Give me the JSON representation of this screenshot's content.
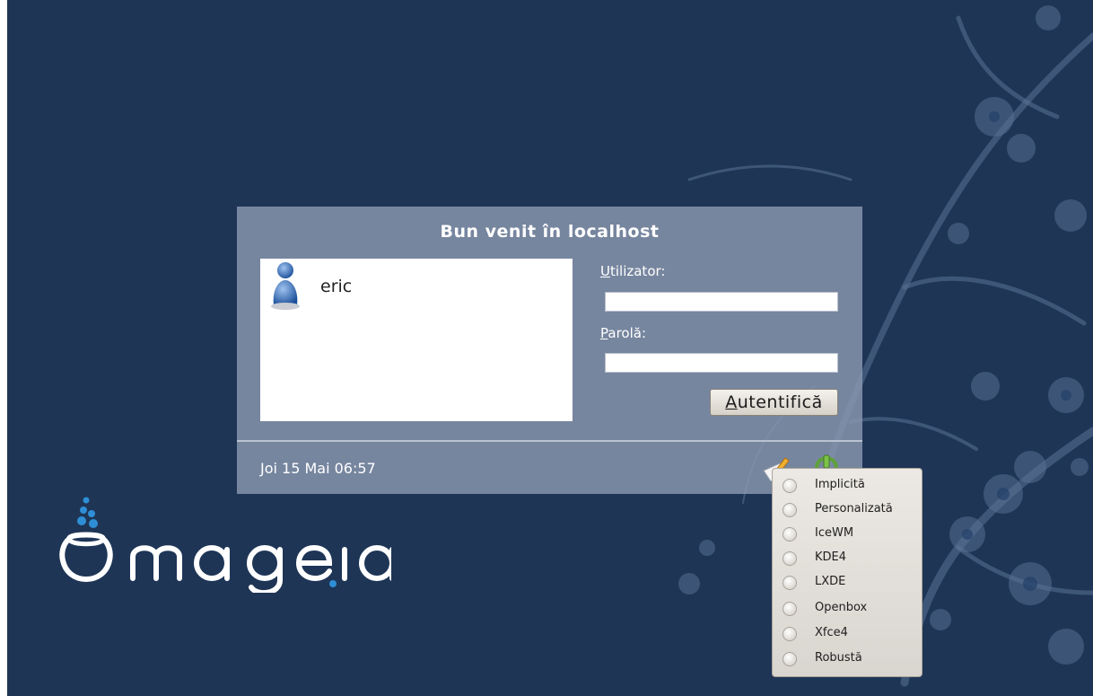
{
  "greeter": {
    "title": "Bun venit în localhost",
    "users": [
      {
        "name": "eric"
      }
    ],
    "username_label_mnemonic": "U",
    "username_label_rest": "tilizator:",
    "username_value": "",
    "password_label_mnemonic": "P",
    "password_label_rest": "arolă:",
    "password_value": "",
    "login_button_mnemonic": "A",
    "login_button_rest": "utentifică",
    "datetime": "Joi 15 Mai 06:57",
    "session_icon": "pencil-paper-icon",
    "power_icon": "power-icon"
  },
  "session_menu": {
    "items": [
      {
        "label": "Implicită"
      },
      {
        "label": "Personalizată"
      },
      {
        "label": "IceWM"
      },
      {
        "label": "KDE4"
      },
      {
        "label": "LXDE"
      },
      {
        "label": "Openbox"
      },
      {
        "label": "Xfce4"
      },
      {
        "label": "Robustă"
      }
    ]
  },
  "branding": {
    "logo_text": "mageia"
  },
  "colors": {
    "background": "#1e3556",
    "panel": "#8b99b0",
    "accent_blue": "#2f8fd6"
  }
}
